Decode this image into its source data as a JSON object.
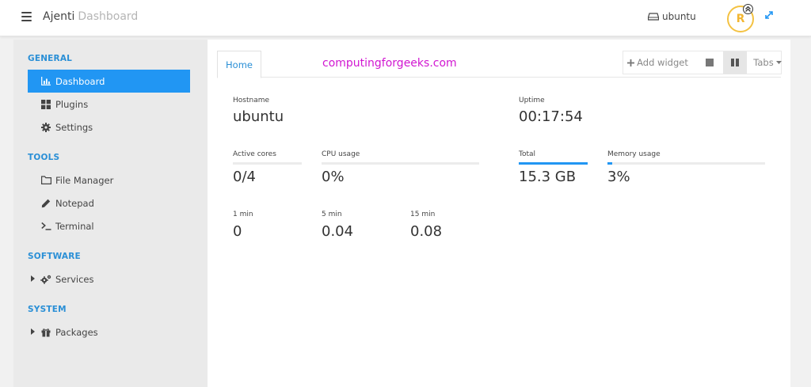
{
  "topbar": {
    "brand": "Ajenti",
    "brand_sub": "Dashboard",
    "host": "ubuntu",
    "avatar_letter": "R"
  },
  "sidebar": {
    "sections": [
      {
        "title": "GENERAL",
        "items": [
          {
            "label": "Dashboard",
            "icon": "bar-chart-icon",
            "active": true
          },
          {
            "label": "Plugins",
            "icon": "th-large-icon"
          },
          {
            "label": "Settings",
            "icon": "gear-icon"
          }
        ]
      },
      {
        "title": "TOOLS",
        "items": [
          {
            "label": "File Manager",
            "icon": "folder-icon"
          },
          {
            "label": "Notepad",
            "icon": "pencil-icon"
          },
          {
            "label": "Terminal",
            "icon": "terminal-icon"
          }
        ]
      },
      {
        "title": "SOFTWARE",
        "items": [
          {
            "label": "Services",
            "icon": "gears-icon",
            "expandable": true
          }
        ]
      },
      {
        "title": "SYSTEM",
        "items": [
          {
            "label": "Packages",
            "icon": "gift-icon",
            "expandable": true
          }
        ]
      }
    ]
  },
  "main": {
    "tab_home": "Home",
    "watermark": "computingforgeeks.com",
    "add_widget": "Add widget",
    "tabs_dropdown": "Tabs",
    "widgets": {
      "hostname": {
        "label": "Hostname",
        "value": "ubuntu"
      },
      "uptime": {
        "label": "Uptime",
        "value": "00:17:54"
      },
      "active_cores": {
        "label": "Active cores",
        "value": "0/4",
        "fraction": 0.0
      },
      "cpu_usage": {
        "label": "CPU usage",
        "value": "0%",
        "fraction": 0.0
      },
      "total": {
        "label": "Total",
        "value": "15.3 GB",
        "fraction": 1.0
      },
      "memory_usage": {
        "label": "Memory usage",
        "value": "3%",
        "fraction": 0.03
      },
      "load_1": {
        "label": "1 min",
        "value": "0"
      },
      "load_5": {
        "label": "5 min",
        "value": "0.04"
      },
      "load_15": {
        "label": "15 min",
        "value": "0.08"
      }
    }
  },
  "colors": {
    "accent": "#2196f3",
    "section_title": "#2a8fd6",
    "watermark": "#d116d1",
    "avatar_ring": "#f4c242"
  }
}
